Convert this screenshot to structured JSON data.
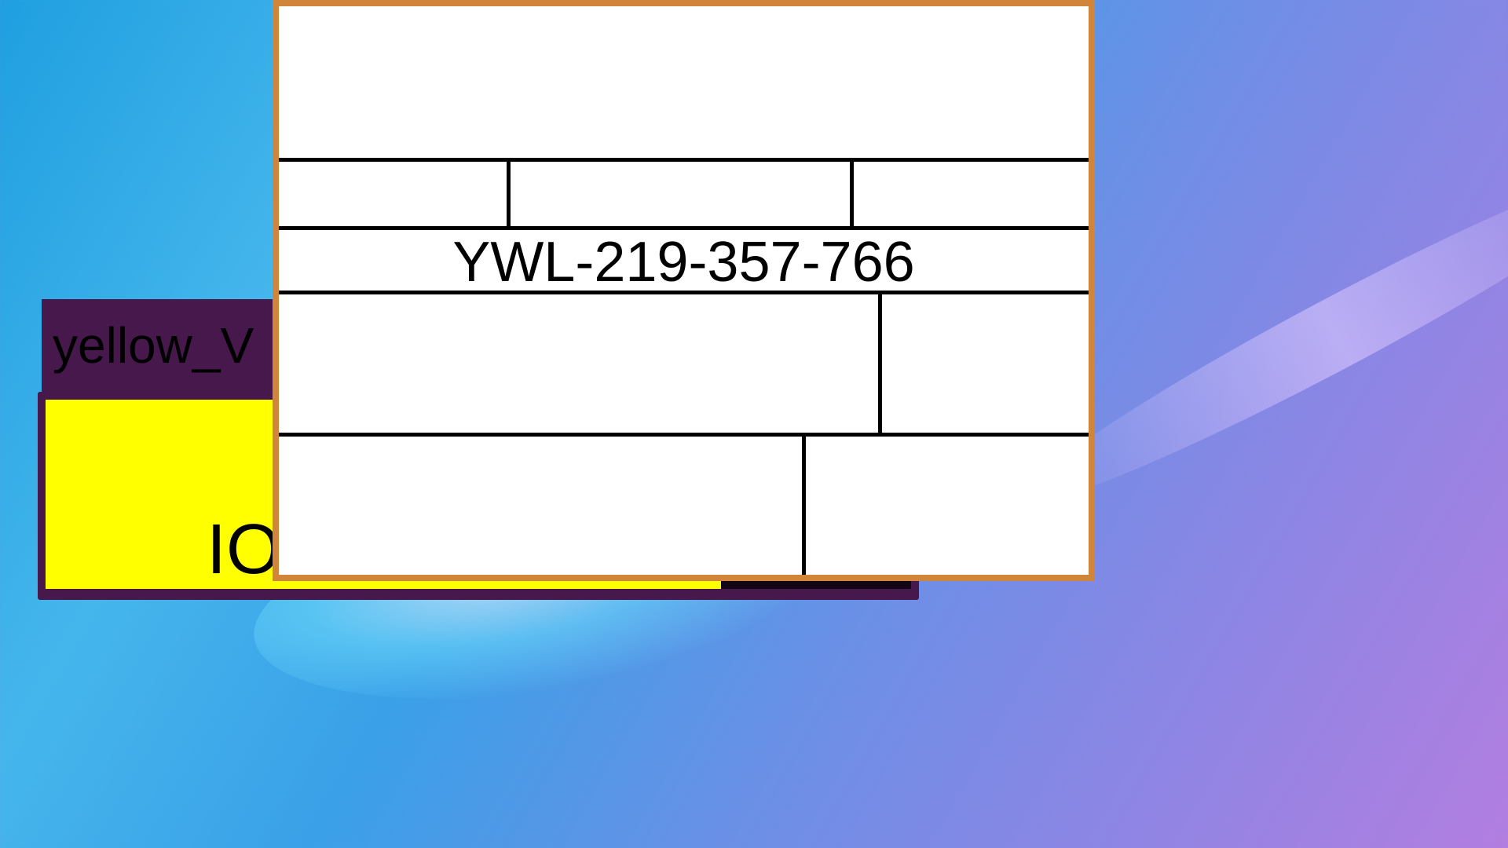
{
  "background_window": {
    "title": "yellow_V",
    "content_text": "IO",
    "colors": {
      "frame": "#46184c",
      "panel": "#ffff00",
      "dark_panel": "#120514"
    }
  },
  "form_window": {
    "code": "YWL-219-357-766",
    "colors": {
      "border": "#d0853a",
      "fill": "#ffffff"
    }
  }
}
